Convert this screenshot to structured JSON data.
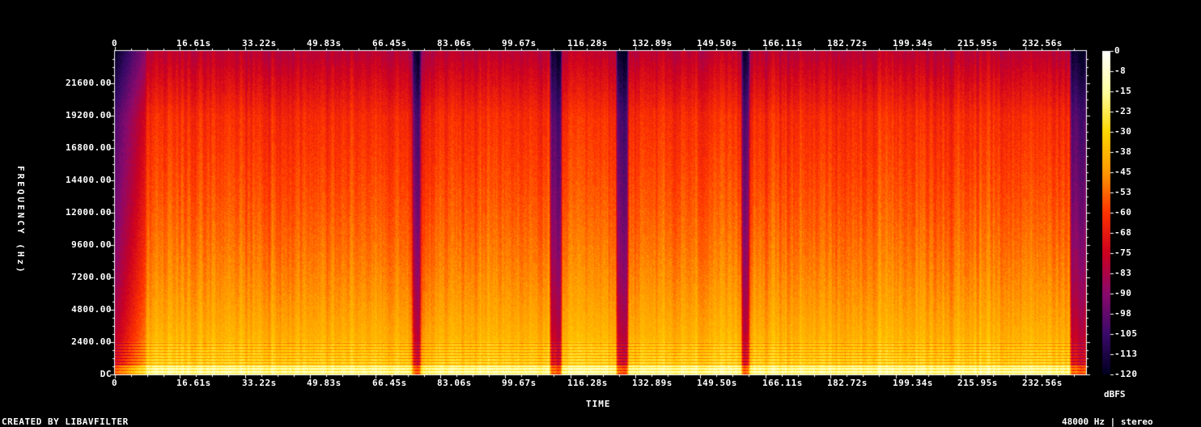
{
  "chart_data": {
    "type": "heatmap",
    "title": "",
    "xlabel": "TIME",
    "ylabel": "FREQUENCY (Hz)",
    "x_ticks": [
      "0",
      "16.61s",
      "33.22s",
      "49.83s",
      "66.45s",
      "83.06s",
      "99.67s",
      "116.28s",
      "132.89s",
      "149.50s",
      "166.11s",
      "182.72s",
      "199.34s",
      "215.95s",
      "232.56s"
    ],
    "x_tick_values": [
      0,
      16.61,
      33.22,
      49.83,
      66.45,
      83.06,
      99.67,
      116.28,
      132.89,
      149.5,
      166.11,
      182.72,
      199.34,
      215.95,
      232.56
    ],
    "y_ticks": [
      "DC",
      "2400.00",
      "4800.00",
      "7200.00",
      "9600.00",
      "12000.00",
      "14400.00",
      "16800.00",
      "19200.00",
      "21600.00"
    ],
    "y_tick_values": [
      0,
      2400,
      4800,
      7200,
      9600,
      12000,
      14400,
      16800,
      19200,
      21600
    ],
    "xlim": [
      0,
      248
    ],
    "ylim": [
      0,
      24000
    ],
    "colorbar": {
      "label": "dBFS",
      "ticks": [
        "0",
        "-8",
        "-15",
        "-23",
        "-30",
        "-38",
        "-45",
        "-53",
        "-60",
        "-68",
        "-75",
        "-83",
        "-90",
        "-98",
        "-105",
        "-113",
        "-120"
      ],
      "range": [
        -120,
        0
      ],
      "colors": [
        "#ffffff",
        "#ffffa0",
        "#ffd700",
        "#ff9900",
        "#ff3300",
        "#cc0020",
        "#8a0a6e",
        "#3a0a6a",
        "#000020"
      ]
    },
    "quiet_segments_s": [
      [
        0,
        3
      ],
      [
        76,
        78
      ],
      [
        111,
        114
      ],
      [
        128,
        131
      ],
      [
        160,
        162
      ],
      [
        244,
        248
      ]
    ]
  },
  "footer": {
    "left": "CREATED BY LIBAVFILTER",
    "right": "48000 Hz | stereo"
  }
}
